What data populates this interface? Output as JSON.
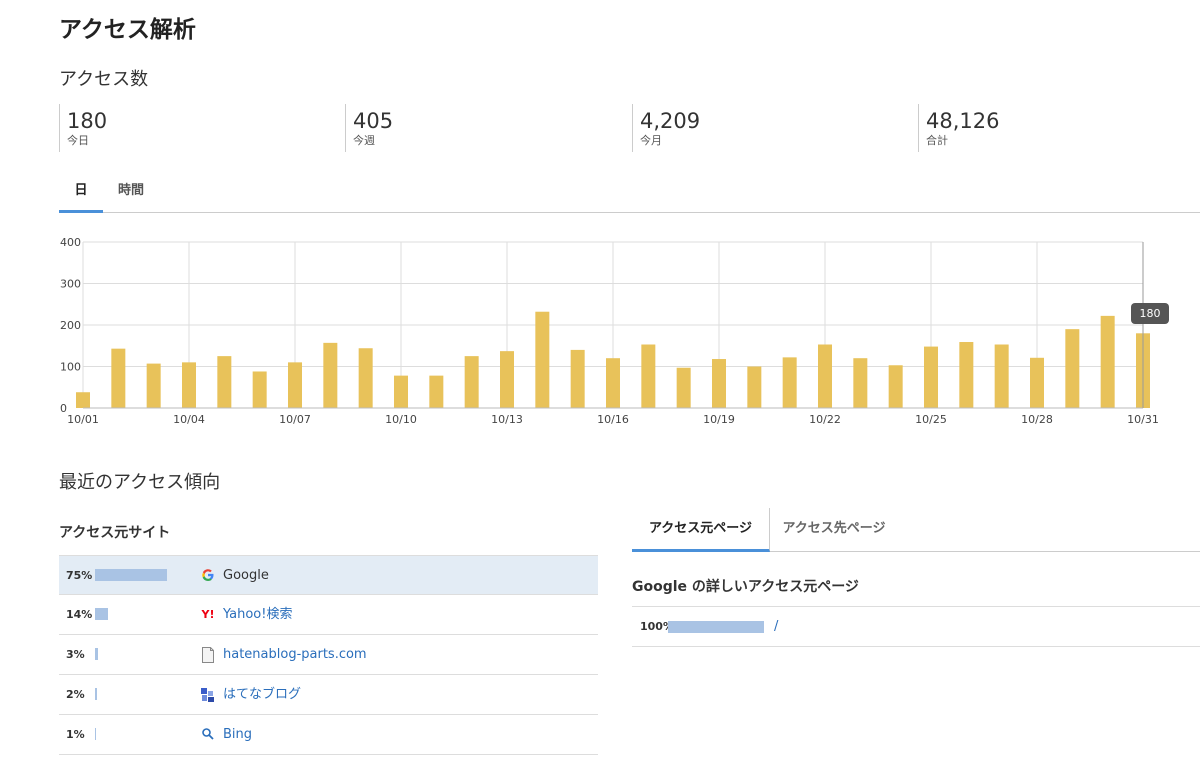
{
  "page": {
    "title": "アクセス解析"
  },
  "access": {
    "title": "アクセス数",
    "stats": [
      {
        "value": "180",
        "label": "今日"
      },
      {
        "value": "405",
        "label": "今週"
      },
      {
        "value": "4,209",
        "label": "今月"
      },
      {
        "value": "48,126",
        "label": "合計"
      }
    ]
  },
  "tabs": [
    {
      "label": "日"
    },
    {
      "label": "時間"
    }
  ],
  "chart_data": {
    "type": "bar",
    "categories": [
      "10/01",
      "10/02",
      "10/03",
      "10/04",
      "10/05",
      "10/06",
      "10/07",
      "10/08",
      "10/09",
      "10/10",
      "10/11",
      "10/12",
      "10/13",
      "10/14",
      "10/15",
      "10/16",
      "10/17",
      "10/18",
      "10/19",
      "10/20",
      "10/21",
      "10/22",
      "10/23",
      "10/24",
      "10/25",
      "10/26",
      "10/27",
      "10/28",
      "10/29",
      "10/30",
      "10/31"
    ],
    "values": [
      38,
      143,
      107,
      110,
      125,
      88,
      110,
      157,
      144,
      78,
      78,
      125,
      137,
      232,
      140,
      120,
      153,
      97,
      118,
      100,
      122,
      153,
      120,
      103,
      148,
      159,
      153,
      121,
      190,
      222,
      180
    ],
    "x_tick_labels": [
      "10/01",
      "10/04",
      "10/07",
      "10/10",
      "10/13",
      "10/16",
      "10/19",
      "10/22",
      "10/25",
      "10/28",
      "10/31"
    ],
    "y_ticks": [
      "0",
      "100",
      "200",
      "300",
      "400"
    ],
    "ylim": [
      0,
      400
    ],
    "grid": true,
    "bar_color": "#e8c25a",
    "tooltip": "180"
  },
  "trend": {
    "title": "最近のアクセス傾向"
  },
  "referrers": {
    "title": "アクセス元サイト",
    "items": [
      {
        "percent": "75%",
        "pct": 75,
        "name": "Google",
        "icon": "google-icon"
      },
      {
        "percent": "14%",
        "pct": 14,
        "name": "Yahoo!検索",
        "icon": "yahoo-icon"
      },
      {
        "percent": "3%",
        "pct": 3,
        "name": "hatenablog-parts.com",
        "icon": "page-icon"
      },
      {
        "percent": "2%",
        "pct": 2,
        "name": "はてなブログ",
        "icon": "hatena-blog-icon"
      },
      {
        "percent": "1%",
        "pct": 1,
        "name": "Bing",
        "icon": "search-icon"
      }
    ]
  },
  "pages": {
    "tabs": [
      {
        "label": "アクセス元ページ"
      },
      {
        "label": "アクセス先ページ"
      }
    ],
    "detail_title": "Google の詳しいアクセス元ページ",
    "rows": [
      {
        "percent": "100%",
        "pct": 100,
        "path": "/"
      }
    ]
  },
  "colors": {
    "accent": "#4a90d9",
    "bar": "#e8c25a",
    "ref_bar": "#a9c3e4",
    "link": "#2a6ebb",
    "highlight": "#e3ecf5"
  }
}
